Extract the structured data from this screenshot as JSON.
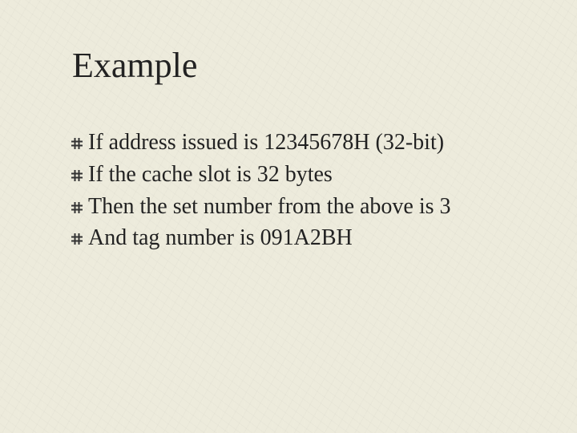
{
  "title": "Example",
  "bullets": [
    "If address issued is 12345678H (32-bit)",
    "If the cache slot is 32 bytes",
    "Then the set number from the above is 3",
    "And tag number is 091A2BH"
  ]
}
